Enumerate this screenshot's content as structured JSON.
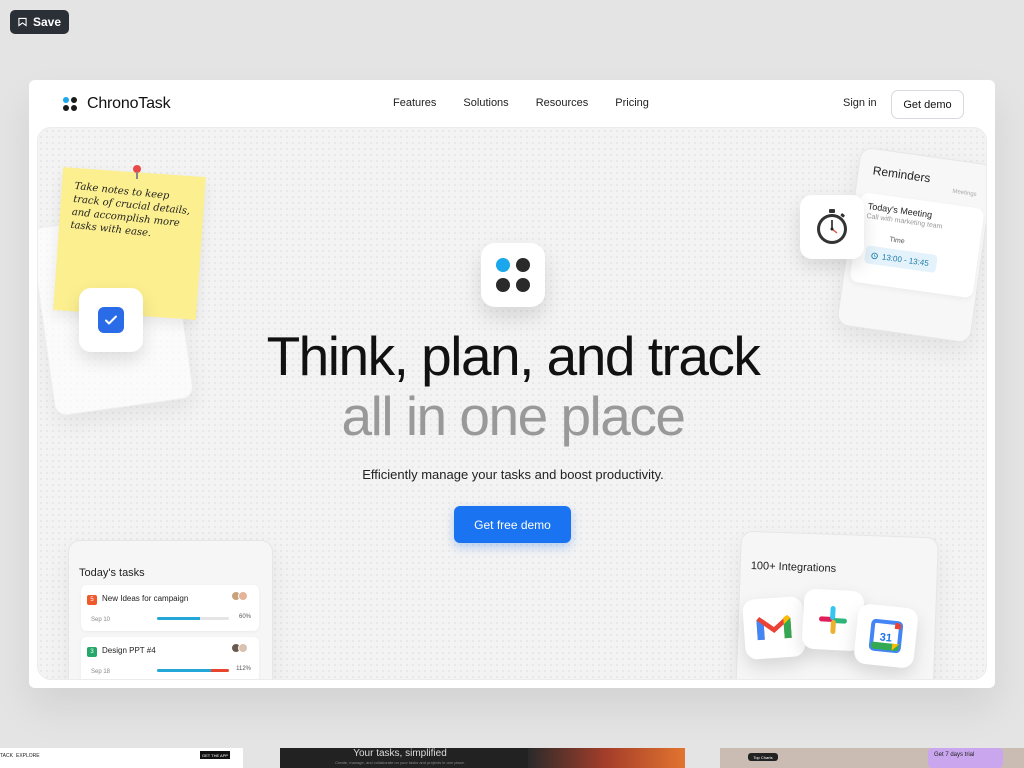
{
  "toolbar": {
    "save_label": "Save"
  },
  "nav": {
    "brand": "ChronoTask",
    "menu": [
      "Features",
      "Solutions",
      "Resources",
      "Pricing"
    ],
    "signin": "Sign in",
    "get_demo": "Get demo"
  },
  "hero": {
    "title_line1": "Think, plan, and track",
    "title_line2": "all in one place",
    "subtitle": "Efficiently manage your tasks and boost productivity.",
    "cta": "Get free demo"
  },
  "sticky_note": {
    "text": "Take notes to keep track of crucial details, and accomplish more tasks with ease."
  },
  "reminders": {
    "title": "Reminders",
    "tag": "Meetings",
    "meeting": "Today's Meeting",
    "meeting_desc": "Call with marketing team",
    "time_label": "Time",
    "time_value": "13:00 - 13:45"
  },
  "tasks": {
    "title": "Today's tasks",
    "items": [
      {
        "num": "5",
        "name": "New Ideas for campaign",
        "date": "Sep 10",
        "pct": "60%",
        "progress": 0.6,
        "color": "#ef5a2c"
      },
      {
        "num": "3",
        "name": "Design PPT #4",
        "date": "Sep 18",
        "pct": "112%",
        "progress": 1.0,
        "color": "#27a86b"
      }
    ]
  },
  "integrations": {
    "title": "100+ Integrations",
    "apps": [
      "gmail-icon",
      "slack-icon",
      "google-calendar-icon"
    ],
    "calendar_day": "31"
  },
  "thumbnails": {
    "t1_left": "TACK",
    "t1_mid": "EXPLORE",
    "t1_btn": "GET THE APP",
    "t2_title": "Your tasks, simplified",
    "t2_sub": "Create, manage, and collaborate on your tasks and projects in one place.",
    "t3_badge": "Top Charts",
    "t3_promo": "Get 7 days trial"
  },
  "colors": {
    "accent": "#1a73f0",
    "bg": "#e4e4e4"
  }
}
